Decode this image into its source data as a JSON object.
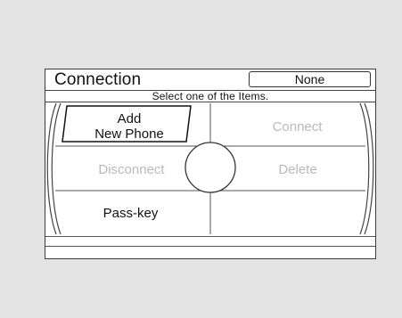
{
  "screen": {
    "title": "Connection",
    "status": "None",
    "instruction": "Select one of the Items."
  },
  "menu": {
    "add_new_phone": {
      "line1": "Add",
      "line2": "New Phone",
      "enabled": true,
      "selected": true
    },
    "connect": {
      "label": "Connect",
      "enabled": false
    },
    "disconnect": {
      "label": "Disconnect",
      "enabled": false
    },
    "delete": {
      "label": "Delete",
      "enabled": false
    },
    "pass_key": {
      "label": "Pass-key",
      "enabled": true
    }
  },
  "colors": {
    "background": "#e3e3e3",
    "screen": "#ffffff",
    "enabled_text": "#111111",
    "disabled_text": "#b9b9b9"
  },
  "icons": {
    "center_knob": "circle-knob-icon"
  }
}
